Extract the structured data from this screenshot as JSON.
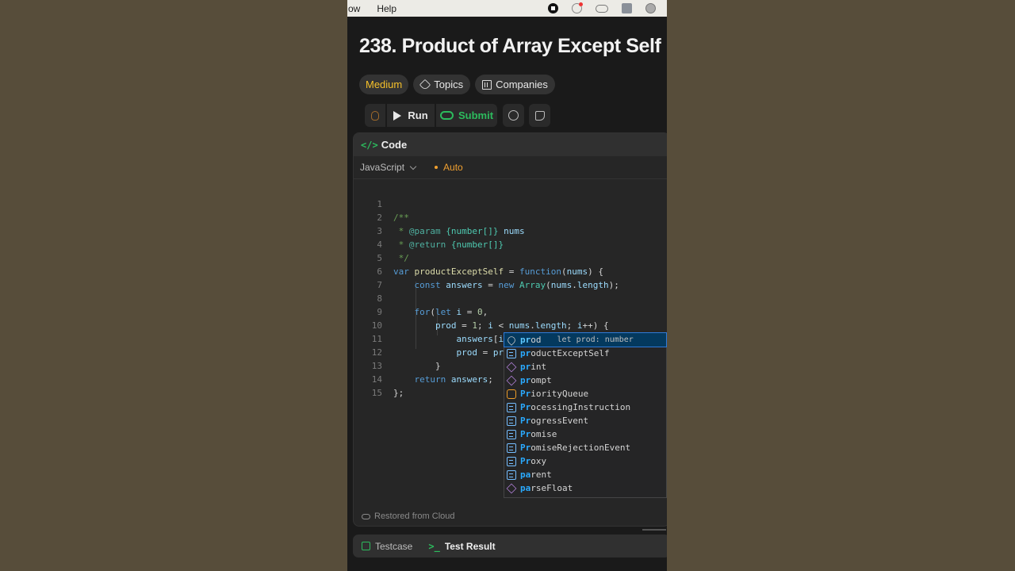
{
  "menubar": {
    "items": [
      "ow",
      "Help"
    ]
  },
  "problem": {
    "title": "238. Product of Array Except Self"
  },
  "tags": {
    "difficulty": "Medium",
    "topics": "Topics",
    "companies": "Companies"
  },
  "toolbar": {
    "run": "Run",
    "submit": "Submit"
  },
  "panel": {
    "title": "Code",
    "language": "JavaScript",
    "mode": "Auto"
  },
  "editor": {
    "line_numbers": [
      "1",
      "2",
      "3",
      "4",
      "5",
      "6",
      "7",
      "8",
      "9",
      "10",
      "11",
      "12",
      "13",
      "14",
      "15"
    ]
  },
  "suggestions": [
    {
      "label": "prod",
      "match": "pr",
      "rest": "od",
      "detail": "let prod: number",
      "kind": "wrench",
      "active": true
    },
    {
      "label": "productExceptSelf",
      "match": "pr",
      "rest": "oductExceptSelf",
      "kind": "var"
    },
    {
      "label": "print",
      "match": "pr",
      "rest": "int",
      "kind": "cube"
    },
    {
      "label": "prompt",
      "match": "pr",
      "rest": "ompt",
      "kind": "cube"
    },
    {
      "label": "PriorityQueue",
      "match": "Pr",
      "rest": "iorityQueue",
      "kind": "cls"
    },
    {
      "label": "ProcessingInstruction",
      "match": "Pr",
      "rest": "ocessingInstruction",
      "kind": "var"
    },
    {
      "label": "ProgressEvent",
      "match": "Pr",
      "rest": "ogressEvent",
      "kind": "var"
    },
    {
      "label": "Promise",
      "match": "Pr",
      "rest": "omise",
      "kind": "var"
    },
    {
      "label": "PromiseRejectionEvent",
      "match": "Pr",
      "rest": "omiseRejectionEvent",
      "kind": "var"
    },
    {
      "label": "Proxy",
      "match": "Pr",
      "rest": "oxy",
      "kind": "var"
    },
    {
      "label": "parent",
      "match": "pa",
      "rest": "rent",
      "kind": "var"
    },
    {
      "label": "parseFloat",
      "match": "pa",
      "rest": "rseFloat",
      "kind": "cube"
    }
  ],
  "footer": {
    "restored": "Restored from Cloud"
  },
  "bottom": {
    "testcase": "Testcase",
    "result": "Test Result"
  }
}
